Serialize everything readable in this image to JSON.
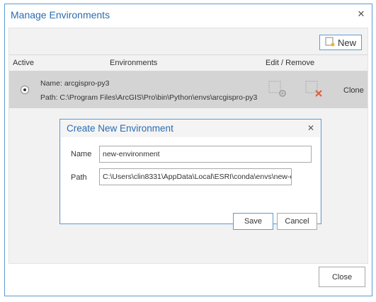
{
  "window": {
    "title": "Manage Environments"
  },
  "toolbar": {
    "new_label": "New"
  },
  "table": {
    "headers": {
      "active": "Active",
      "environments": "Environments",
      "edit_remove": "Edit / Remove"
    },
    "rows": [
      {
        "name_label": "Name: arcgispro-py3",
        "path_label": "Path: C:\\Program Files\\ArcGIS\\Pro\\bin\\Python\\envs\\arcgispro-py3",
        "clone_label": "Clone",
        "active": true
      }
    ]
  },
  "footer": {
    "close_label": "Close"
  },
  "modal": {
    "title": "Create New Environment",
    "name_label": "Name",
    "name_value": "new-environment",
    "path_label": "Path",
    "path_value": "C:\\Users\\clin8331\\AppData\\Local\\ESRI\\conda\\envs\\new-envir",
    "save_label": "Save",
    "cancel_label": "Cancel"
  },
  "colors": {
    "accent": "#2b6cb0",
    "border_blue": "#5b9bd5",
    "row_selected": "#d4d4d4",
    "remove_icon": "#e35b3a"
  },
  "icons": {
    "new": "new-environment-icon",
    "edit": "edit-settings-icon",
    "remove": "remove-x-icon",
    "close": "close-icon"
  }
}
